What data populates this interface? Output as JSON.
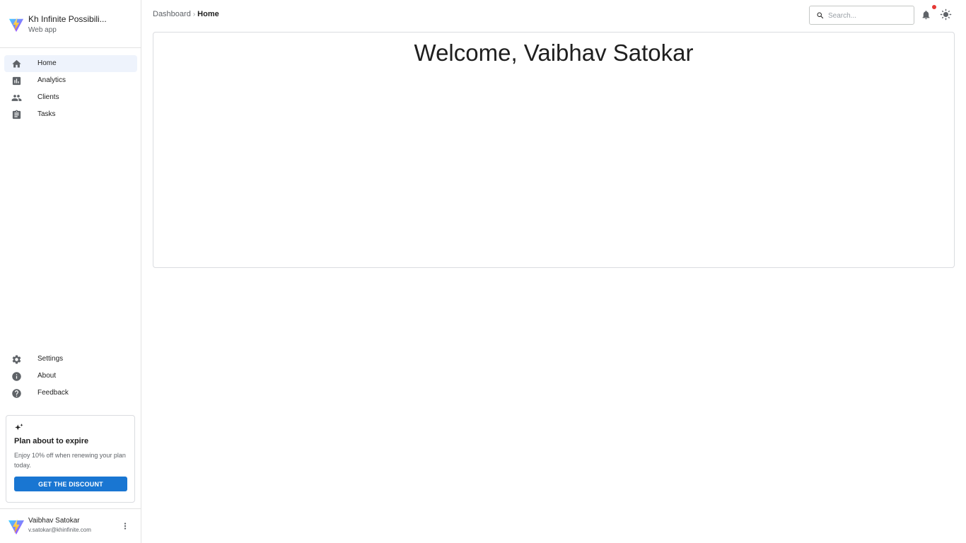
{
  "brand": {
    "title": "Kh Infinite Possibili...",
    "subtitle": "Web app",
    "logo_icon": "v-logo-icon"
  },
  "nav": {
    "main": [
      {
        "label": "Home",
        "icon": "home-icon",
        "active": true
      },
      {
        "label": "Analytics",
        "icon": "bar-chart-icon",
        "active": false
      },
      {
        "label": "Clients",
        "icon": "people-icon",
        "active": false
      },
      {
        "label": "Tasks",
        "icon": "clipboard-icon",
        "active": false
      }
    ],
    "secondary": [
      {
        "label": "Settings",
        "icon": "gear-icon"
      },
      {
        "label": "About",
        "icon": "info-icon"
      },
      {
        "label": "Feedback",
        "icon": "help-icon"
      }
    ]
  },
  "promo": {
    "icon": "sparkles-icon",
    "title": "Plan about to expire",
    "text": "Enjoy 10% off when renewing your plan today.",
    "button_label": "GET THE DISCOUNT"
  },
  "user": {
    "name": "Vaibhav Satokar",
    "email": "v.satokar@khinfinite.com"
  },
  "breadcrumb": {
    "root": "Dashboard",
    "separator": "›",
    "current": "Home"
  },
  "search": {
    "placeholder": "Search...",
    "value": ""
  },
  "main": {
    "welcome": "Welcome, Vaibhav Satokar"
  },
  "colors": {
    "accent": "#1976d2",
    "active_nav_bg": "#eef3fc",
    "notification_dot": "#e53935",
    "icon_gray": "#5f6368"
  }
}
